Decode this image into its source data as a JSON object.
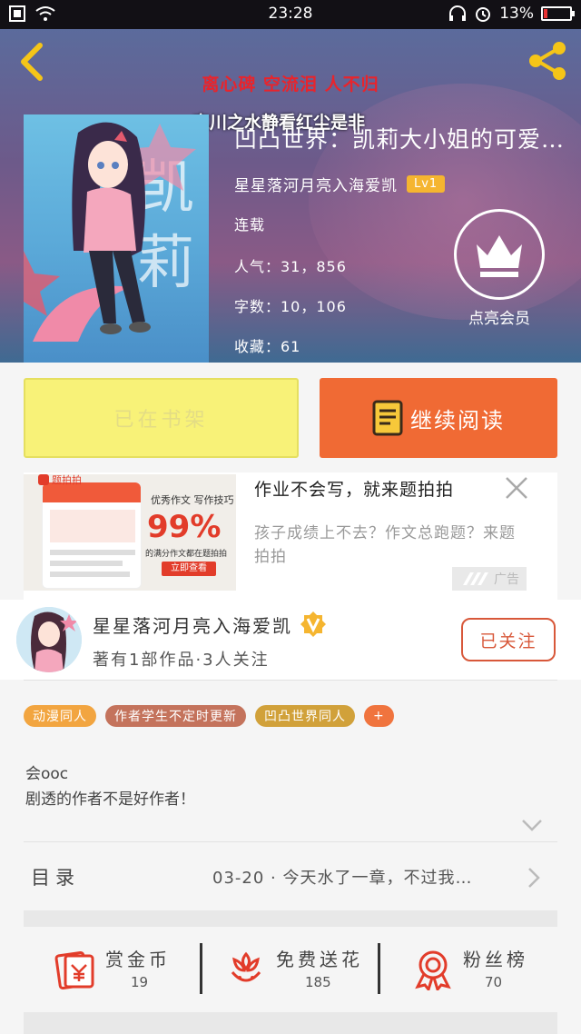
{
  "status_bar": {
    "time": "23:28",
    "battery": "13%",
    "battery_level": 0.13
  },
  "header": {
    "banner_red": "离心碑 空流泪 人不归",
    "banner_white": "忘川之水静看红尘是非",
    "cover_char": "凯莉"
  },
  "book": {
    "title": "凹凸世界：凯莉大小姐的可爱…",
    "author": "星星落河月亮入海爱凯",
    "level": "Lv1",
    "status": "连载",
    "popularity": "人气：31，856",
    "word_count": "字数：10，106",
    "favorites": "收藏：61"
  },
  "vip": {
    "label": "点亮会员"
  },
  "actions": {
    "shelf_label": "已在书架",
    "read_label": "继续阅读"
  },
  "ad": {
    "title": "作业不会写，就来题拍拍",
    "desc": "孩子成绩上不去？作文总跑题？来题拍拍",
    "tag": "广告",
    "img_app": "题拍拍",
    "img_head1": "优秀作文",
    "img_head2": "写作技巧",
    "img_percent": "99%",
    "img_sub": "的满分作文都在题拍拍",
    "img_btn": "立即查看"
  },
  "author_card": {
    "name": "星星落河月亮入海爱凯",
    "stats": "著有1部作品·3人关注",
    "follow_label": "已关注"
  },
  "tags": [
    {
      "label": "动漫同人",
      "color": "#f2a540"
    },
    {
      "label": "作者学生不定时更新",
      "color": "#c4735c"
    },
    {
      "label": "凹凸世界同人",
      "color": "#d1a13a"
    },
    {
      "label": "+",
      "color": "#f0743e"
    }
  ],
  "intro": {
    "line1": "会ooc",
    "line2": "剧透的作者不是好作者！"
  },
  "toc": {
    "label": "目录",
    "latest": "03-20 · 今天水了一章，不过我…"
  },
  "stats": [
    {
      "label": "赏金币",
      "value": "19"
    },
    {
      "label": "免费送花",
      "value": "185"
    },
    {
      "label": "粉丝榜",
      "value": "70"
    }
  ],
  "colors": {
    "accent": "#f06a34",
    "shelf_bg": "#f8f278",
    "icon_red": "#e23c2a"
  }
}
